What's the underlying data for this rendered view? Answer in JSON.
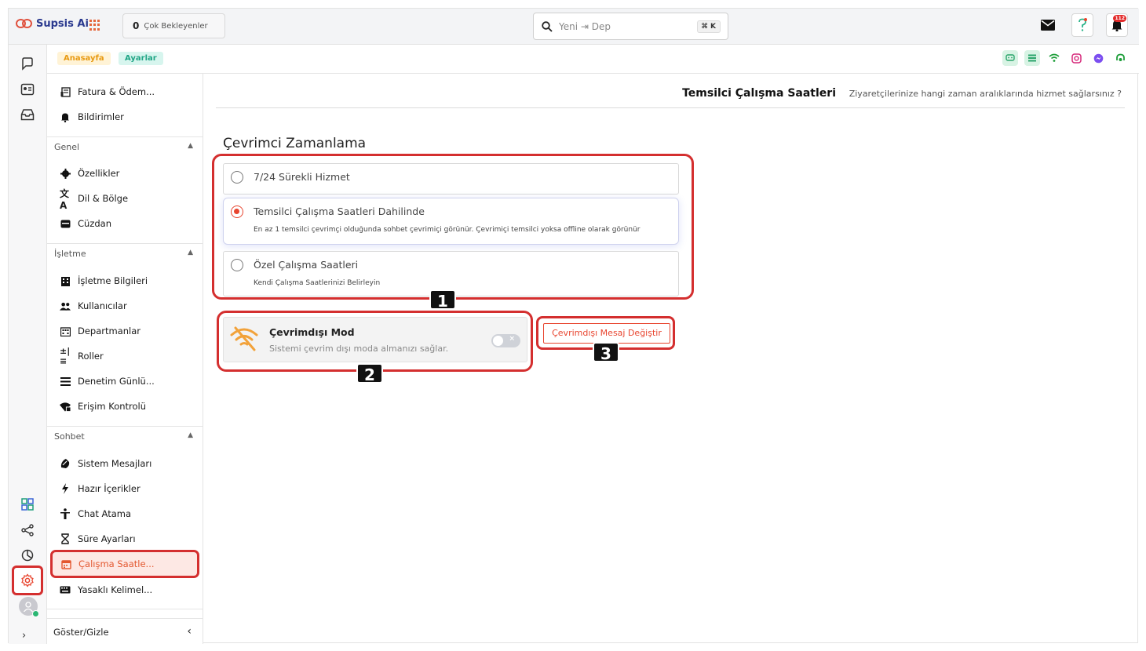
{
  "topbar": {
    "logo_text": "Supsis Ai",
    "pending_count": "0",
    "pending_label": "Çok Bekleyenler",
    "search_value": "Yeni ⇥ Dep",
    "search_shortcut": "⌘ K",
    "notification_count": "112",
    "accent": "#e8452f"
  },
  "breadcrumb": {
    "home": "Anasayfa",
    "settings": "Ayarlar"
  },
  "sidebar": {
    "top_items": [
      {
        "label": "Fatura & Ödem...",
        "icon": "invoice-icon"
      },
      {
        "label": "Bildirimler",
        "icon": "bell-icon"
      }
    ],
    "sections": [
      {
        "title": "Genel",
        "items": [
          {
            "label": "Özellikler",
            "icon": "gear-icon"
          },
          {
            "label": "Dil & Bölge",
            "icon": "translate-icon"
          },
          {
            "label": "Cüzdan",
            "icon": "wallet-icon"
          }
        ]
      },
      {
        "title": "İşletme",
        "items": [
          {
            "label": "İşletme Bilgileri",
            "icon": "building-icon"
          },
          {
            "label": "Kullanıcılar",
            "icon": "users-icon"
          },
          {
            "label": "Departmanlar",
            "icon": "department-icon"
          },
          {
            "label": "Roller",
            "icon": "roles-icon"
          },
          {
            "label": "Denetim Günlü...",
            "icon": "list-icon"
          },
          {
            "label": "Erişim Kontrolü",
            "icon": "access-icon"
          }
        ]
      },
      {
        "title": "Sohbet",
        "items": [
          {
            "label": "Sistem Mesajları",
            "icon": "system-message-icon"
          },
          {
            "label": "Hazır İçerikler",
            "icon": "lightning-icon"
          },
          {
            "label": "Chat Atama",
            "icon": "assign-icon"
          },
          {
            "label": "Süre Ayarları",
            "icon": "hourglass-icon"
          },
          {
            "label": "Çalışma Saatle...",
            "icon": "calendar-icon",
            "active": true
          },
          {
            "label": "Yasaklı Kelimel...",
            "icon": "keyboard-icon"
          }
        ]
      }
    ],
    "footer": "Göster/Gizle"
  },
  "page": {
    "title": "Temsilci Çalışma Saatleri",
    "subtitle": "Ziyaretçilerinize hangi zaman aralıklarında hizmet sağlarsınız ?",
    "section_title": "Çevrimci Zamanlama",
    "options": [
      {
        "label": "7/24 Sürekli Hizmet",
        "description": "",
        "selected": false
      },
      {
        "label": "Temsilci Çalışma Saatleri Dahilinde",
        "description": "En az 1 temsilci çevrimçi olduğunda sohbet çevrimiçi görünür. Çevrimiçi temsilci yoksa offline olarak görünür",
        "selected": true
      },
      {
        "label": "Özel Çalışma Saatleri",
        "description": "Kendi Çalışma Saatlerinizi Belirleyin",
        "selected": false
      }
    ],
    "offline": {
      "title": "Çevrimdışı Mod",
      "description": "Sistemi çevrim dışı moda almanızı sağlar.",
      "enabled": false
    },
    "offline_message_button": "Çevrimdışı Mesaj Değiştir"
  },
  "callouts": [
    "1",
    "2",
    "3"
  ]
}
